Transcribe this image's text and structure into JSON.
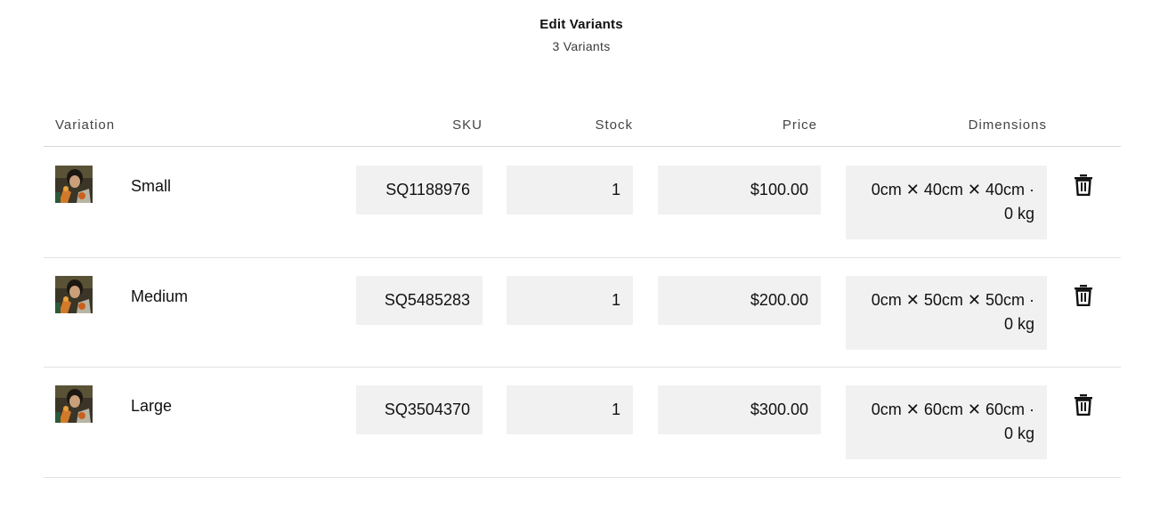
{
  "header": {
    "title": "Edit Variants",
    "subtitle": "3 Variants"
  },
  "columns": {
    "variation": "Variation",
    "sku": "SKU",
    "stock": "Stock",
    "price": "Price",
    "dimensions": "Dimensions"
  },
  "variants": [
    {
      "name": "Small",
      "sku": "SQ1188976",
      "stock": "1",
      "price": "$100.00",
      "dimensions_line1": "0cm ✕ 40cm ✕ 40cm ·",
      "dimensions_line2": "0 kg"
    },
    {
      "name": "Medium",
      "sku": "SQ5485283",
      "stock": "1",
      "price": "$200.00",
      "dimensions_line1": "0cm ✕ 50cm ✕ 50cm ·",
      "dimensions_line2": "0 kg"
    },
    {
      "name": "Large",
      "sku": "SQ3504370",
      "stock": "1",
      "price": "$300.00",
      "dimensions_line1": "0cm ✕ 60cm ✕ 60cm ·",
      "dimensions_line2": "0 kg"
    }
  ],
  "icons": {
    "thumbnail": "product-thumbnail",
    "delete": "trash-icon"
  },
  "colors": {
    "field_background": "#f1f1f1",
    "divider": "#e2e2e2",
    "text": "#111111"
  }
}
